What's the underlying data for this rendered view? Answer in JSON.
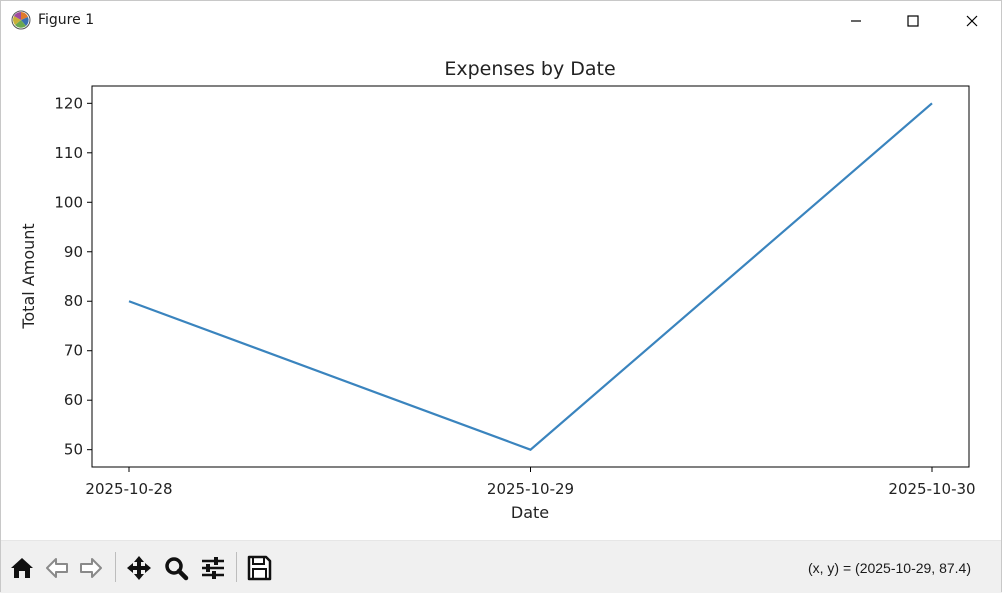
{
  "window": {
    "title": "Figure 1",
    "minimize_icon": "minimize-icon",
    "maximize_icon": "maximize-icon",
    "close_icon": "close-icon"
  },
  "toolbar": {
    "buttons": [
      {
        "name": "home",
        "icon": "home-icon"
      },
      {
        "name": "back",
        "icon": "arrow-left-icon"
      },
      {
        "name": "forward",
        "icon": "arrow-right-icon"
      },
      {
        "name": "pan",
        "icon": "move-icon"
      },
      {
        "name": "zoom",
        "icon": "magnifier-icon"
      },
      {
        "name": "configure",
        "icon": "sliders-icon"
      },
      {
        "name": "save",
        "icon": "floppy-icon"
      }
    ],
    "coords_text": "(x, y) = (2025-10-29, 87.4)"
  },
  "colors": {
    "line": "#3a84be",
    "axes": "#000000",
    "text": "#222222"
  },
  "chart_data": {
    "type": "line",
    "title": "Expenses by Date",
    "xlabel": "Date",
    "ylabel": "Total Amount",
    "categories": [
      "2025-10-28",
      "2025-10-29",
      "2025-10-30"
    ],
    "series": [
      {
        "values": [
          80,
          50,
          120
        ]
      }
    ],
    "ylim": [
      46.5,
      123.5
    ],
    "yticks": [
      50,
      60,
      70,
      80,
      90,
      100,
      110,
      120
    ],
    "grid": false
  }
}
